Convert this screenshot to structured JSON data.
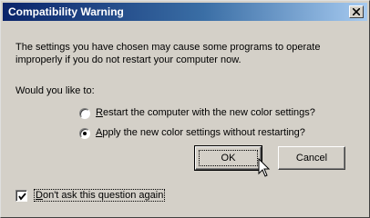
{
  "window": {
    "title": "Compatibility Warning"
  },
  "message": {
    "text": "The settings you have chosen may cause some programs to operate improperly if you do not restart your computer now."
  },
  "question": {
    "text": "Would you like to:"
  },
  "options": [
    {
      "mnemonic": "R",
      "rest": "estart the computer with the new color settings?",
      "selected": false
    },
    {
      "mnemonic": "A",
      "rest": "pply the new color settings without restarting?",
      "selected": true
    }
  ],
  "buttons": {
    "ok": "OK",
    "cancel": "Cancel"
  },
  "checkbox": {
    "mnemonic": "D",
    "rest": "on't ask this question again",
    "checked": true
  },
  "colors": {
    "titlebar_start": "#0a246a",
    "titlebar_end": "#a6caf0",
    "face": "#d4d0c8"
  }
}
